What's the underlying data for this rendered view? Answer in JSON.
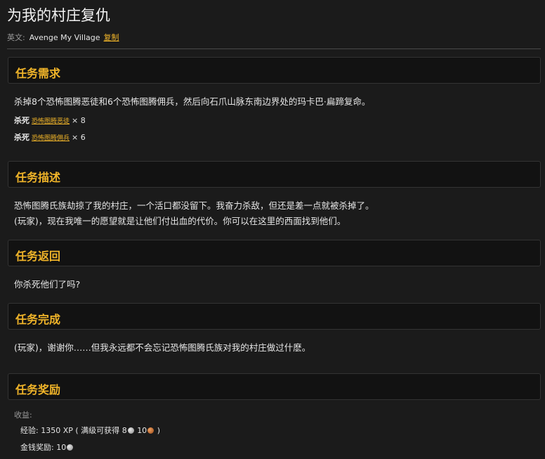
{
  "quest": {
    "title": "为我的村庄复仇",
    "english_label": "英文:",
    "english_name": "Avenge My Village",
    "copy_label": "复制"
  },
  "sections": {
    "requirements": {
      "heading": "任务需求",
      "text": "杀掉8个恐怖图腾恶徒和6个恐怖图腾佣兵，然后向石爪山脉东南边界处的玛卡巴·扁蹄复命。",
      "objectives": [
        {
          "verb": "杀死",
          "target": "恐怖图腾恶徒",
          "count": "× 8"
        },
        {
          "verb": "杀死",
          "target": "恐怖图腾佣兵",
          "count": "× 6"
        }
      ]
    },
    "description": {
      "heading": "任务描述",
      "line1": "恐怖图腾氏族劫掠了我的村庄，一个活口都没留下。我奋力杀敌，但还是差一点就被杀掉了。",
      "line2": "(玩家)，现在我唯一的愿望就是让他们付出血的代价。你可以在这里的西面找到他们。"
    },
    "progress": {
      "heading": "任务返回",
      "text": "你杀死他们了吗?"
    },
    "completion": {
      "heading": "任务完成",
      "text": "(玩家)，谢谢你……但我永远都不会忘记恐怖图腾氏族对我的村庄做过什麽。"
    },
    "rewards": {
      "heading": "任务奖励",
      "gain_label": "收益:",
      "xp_label": "经验:",
      "xp_value": "1350 XP",
      "xp_max_prefix": "( 满级可获得",
      "xp_max_silver": "8",
      "xp_max_copper": "10",
      "xp_max_suffix": ")",
      "money_label": "金钱奖励:",
      "money_silver": "10"
    }
  },
  "colors": {
    "accent": "#f0b429",
    "background": "#1b1b1b",
    "header_bg": "#121212"
  },
  "icons": {
    "silver": "silver-coin-icon",
    "copper": "copper-coin-icon"
  }
}
